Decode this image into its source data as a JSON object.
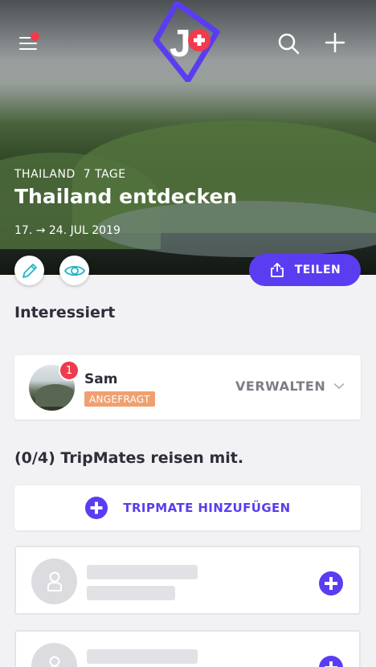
{
  "hero": {
    "country": "THAILAND",
    "duration": "7 TAGE",
    "title": "Thailand entdecken",
    "dates": "17. → 24. JUL 2019",
    "share_label": "TEILEN"
  },
  "interested": {
    "title": "Interessiert",
    "member": {
      "name": "Sam",
      "status": "ANGEFRAGT",
      "notification_count": "1",
      "manage_label": "VERWALTEN"
    }
  },
  "tripmates": {
    "title": "(0/4) TripMates reisen mit.",
    "add_label": "TRIPMATE HINZUFÜGEN"
  },
  "colors": {
    "accent": "#5a3df0",
    "badge_red": "#ef3b4d",
    "status_orange": "#f0a070"
  },
  "icons": {
    "menu": "menu-icon",
    "logo": "app-logo",
    "search": "search-icon",
    "add": "plus-icon",
    "edit": "pencil-icon",
    "view": "eye-icon",
    "share": "share-icon",
    "manage": "chevron-down-icon",
    "add_mate": "plus-circle-icon",
    "placeholder_avatar": "user-icon"
  }
}
